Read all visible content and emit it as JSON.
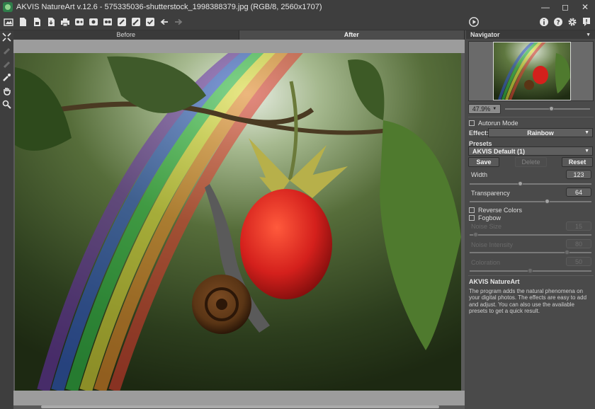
{
  "app": {
    "title": "AKVIS NatureArt v.12.6 - 575335036-shutterstock_1998388379.jpg (RGB/8, 2560x1707)"
  },
  "window_controls": [
    "minimize-icon",
    "maximize-icon",
    "close-icon"
  ],
  "toolbar": {
    "left_icons": [
      "open-icon",
      "save-icon",
      "save-as-icon",
      "export-icon",
      "print-icon",
      "batch-icon",
      "share-icon",
      "presets-icon",
      "brush-icon",
      "brush-settings-icon",
      "checkmark-icon",
      "undo-icon",
      "redo-icon"
    ],
    "right_icons": [
      "info-icon",
      "help-icon",
      "settings-icon",
      "feedback-icon"
    ],
    "run_icon": "play-icon"
  },
  "left_tools": [
    "fit-icon",
    "mask-icon",
    "eraser-icon",
    "paint-icon",
    "hand-icon",
    "zoom-icon"
  ],
  "canvas": {
    "tab_before": "Before",
    "tab_after": "After",
    "active_tab": "After"
  },
  "navigator": {
    "header": "Navigator",
    "zoom": "47.9%",
    "zoom_level": 0.55
  },
  "settings": {
    "autorun_label": "Autorun Mode",
    "autorun_checked": false,
    "effect_label": "Effect:",
    "effect_value": "Rainbow",
    "presets_label": "Presets",
    "preset_value": "AKVIS Default (1)",
    "save_label": "Save",
    "delete_label": "Delete",
    "reset_label": "Reset",
    "width_label": "Width",
    "width_value": "123",
    "width_level": 0.42,
    "transparency_label": "Transparency",
    "transparency_value": "64",
    "transparency_level": 0.64,
    "reverse_label": "Reverse Colors",
    "fogbow_label": "Fogbow",
    "noise_size_label": "Noise Size",
    "noise_size_value": "15",
    "noise_size_level": 0.05,
    "noise_intensity_label": "Noise Intensity",
    "noise_intensity_value": "80",
    "noise_intensity_level": 0.8,
    "coloration_label": "Coloration",
    "coloration_value": "50",
    "coloration_level": 0.5
  },
  "about": {
    "title": "AKVIS NatureArt",
    "text": "The program adds the natural phenomena on your digital photos. The effects are easy to add and adjust. You can also use the available presets to get a quick result."
  },
  "colors": {
    "chrome_dark": "#3e3e3e",
    "panel_bg": "#4a4a4a",
    "canvas_gray": "#9c9c9c"
  }
}
